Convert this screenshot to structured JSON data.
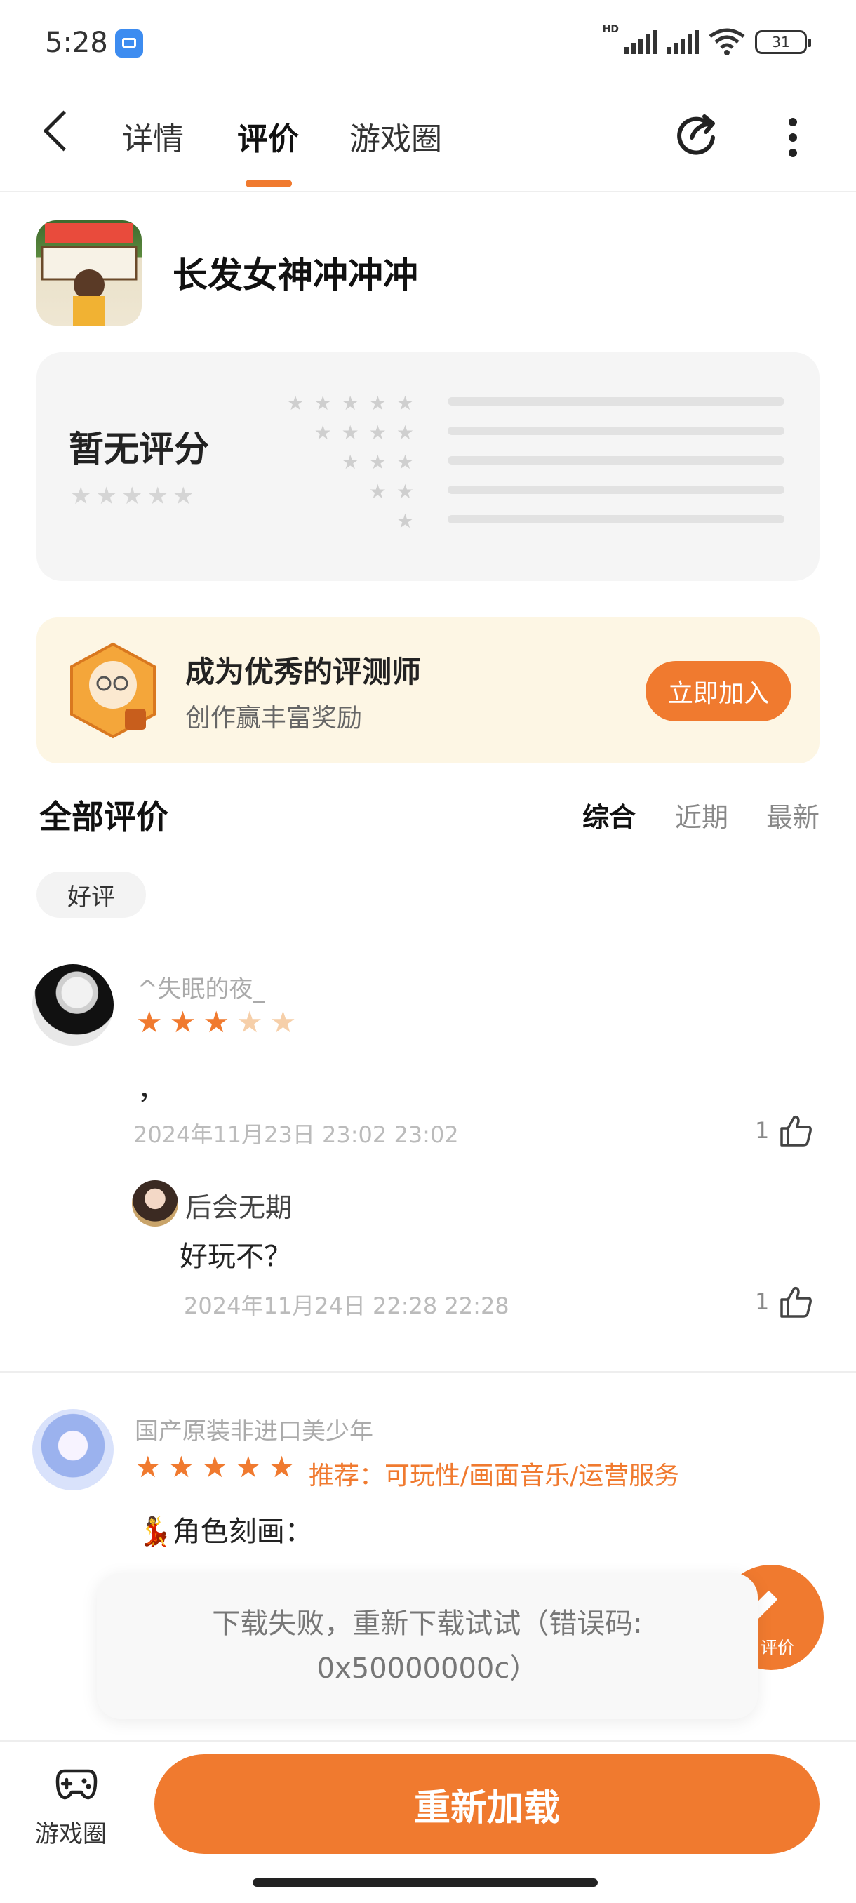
{
  "status_bar": {
    "time": "5:28",
    "network": "HD",
    "battery": "31"
  },
  "nav": {
    "tabs": [
      {
        "label": "详情"
      },
      {
        "label": "评价"
      },
      {
        "label": "游戏圈"
      }
    ],
    "active_tab": "评价"
  },
  "game": {
    "title": "长发女神冲冲冲"
  },
  "rating": {
    "label": "暂无评分"
  },
  "banner": {
    "title": "成为优秀的评测师",
    "subtitle": "创作赢丰富奖励",
    "join_label": "立即加入"
  },
  "reviews_section": {
    "title": "全部评价",
    "sort_options": [
      {
        "label": "综合"
      },
      {
        "label": "近期"
      },
      {
        "label": "最新"
      }
    ],
    "active_sort": "综合",
    "filter_chip": "好评"
  },
  "reviews": [
    {
      "username": "^失眠的夜_",
      "rating": 3,
      "text": "，",
      "date": "2024年11月23日 23:02 23:02",
      "likes": "1",
      "reply": {
        "username": "后会无期",
        "text": "好玩不？",
        "date": "2024年11月24日 22:28 22:28",
        "likes": "1"
      }
    },
    {
      "username": "国产原装非进口美少年",
      "rating": 5,
      "recommend": "推荐：可玩性/画面音乐/运营服务",
      "text": "💃角色刻画："
    }
  ],
  "toast": {
    "line1": "下载失败，重新下载试试（错误码:",
    "line2": "0x50000000c）"
  },
  "fab": {
    "label": "评价"
  },
  "bottom": {
    "game_circle_label": "游戏圈",
    "reload_label": "重新加载"
  },
  "colors": {
    "accent": "#f07a2f",
    "banner_bg": "#fdf6e4",
    "card_bg": "#f5f5f5"
  }
}
